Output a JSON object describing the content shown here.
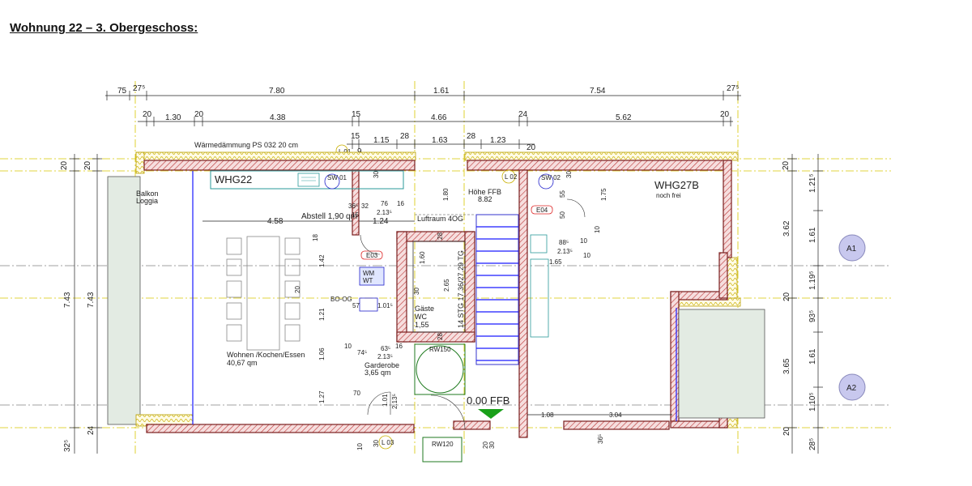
{
  "title": "Wohnung 22 – 3. Obergeschoss:",
  "rooms": {
    "whg22": "WHG22",
    "whg27b": "WHG27B",
    "whg27b_note": "noch frei",
    "balkon": "Balkon",
    "loggia": "Loggia",
    "wohnen_name": "Wohnen /Kochen/Essen",
    "wohnen_area": "40,67 qm",
    "abstell": "Abstell 1,90 qm",
    "luftraum": "Luftraum 4OG",
    "gaeste1": "Gäste",
    "gaeste2": "WC",
    "gaeste3": "1,55",
    "garderobe1": "Garderobe",
    "garderobe2": "3,65 qm",
    "hoehe": "Höhe FFB",
    "hoehe_val": "8.82",
    "ffb": "0.00 FFB",
    "insulation": "Wärmedämmung PS 032 20 cm",
    "stair": "14 STG 17.36/27.29 TG",
    "wm": "WM",
    "wt": "WT"
  },
  "tags": {
    "sw01": "SW 01",
    "sw02": "SW 02",
    "e03": "E03",
    "e04": "E04",
    "rw150": "RW150",
    "rw120": "RW120",
    "l01": "L 01",
    "l02": "L 02",
    "l03": "L 03",
    "bo": "BO-OG"
  },
  "axes": {
    "a1": "A1",
    "a2": "A2"
  },
  "dims": {
    "top1": [
      "75",
      "27⁵",
      "7.80",
      "1.61",
      "7.54",
      "27⁵"
    ],
    "top2": [
      "20",
      "1.30",
      "20",
      "4.38",
      "15",
      "4.66",
      "24",
      "5.62",
      "20"
    ],
    "top3": [
      "15",
      "1.15",
      "28",
      "1.63",
      "28",
      "1.23",
      "20"
    ],
    "top3b": [
      "9"
    ],
    "left": [
      "20",
      "20",
      "7.43",
      "7.43",
      "24",
      "32⁵"
    ],
    "right": [
      "20",
      "1.21⁵",
      "3.62",
      "1.61",
      "20",
      "1.19⁵",
      "93⁵",
      "3.65",
      "1.61",
      "1.10⁵",
      "20",
      "28⁵"
    ],
    "inner": [
      "4.58",
      "1.24",
      "36⁵",
      "32",
      "76",
      "16",
      "2.13⁵",
      "15",
      "18",
      "1.42",
      "20",
      "1.21",
      "1.06",
      "1.27",
      "57",
      "1.01⁵",
      "10",
      "74⁵",
      "63⁵",
      "16",
      "2.13⁵",
      "70",
      "1.01",
      "2.13⁵",
      "1.60",
      "2.65",
      "30",
      "28",
      "28",
      "1.80",
      "30",
      "1.75",
      "50",
      "55",
      "30",
      "10",
      "88⁵",
      "10",
      "2.13⁵",
      "1.65",
      "10",
      "1.08",
      "3.04",
      "36⁵",
      "30",
      "10",
      "20",
      "30"
    ]
  }
}
